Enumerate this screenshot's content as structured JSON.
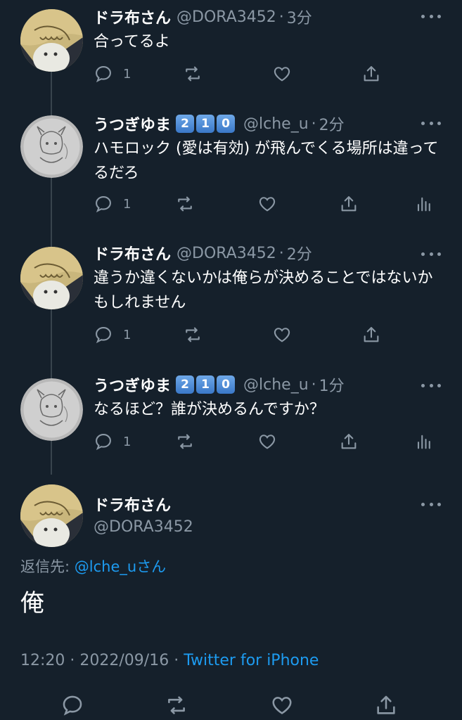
{
  "tweets": [
    {
      "name": "ドラ布さん",
      "handle": "@DORA3452",
      "dot": "·",
      "time": "3分",
      "text": "合ってるよ",
      "reply_count": "1",
      "verified_emoji": []
    },
    {
      "name": "うつぎゆま",
      "handle": "@lche_u",
      "dot": "·",
      "time": "2分",
      "text": "ハモロック (愛は有効) が飛んでくる場所は違ってるだろ",
      "reply_count": "1",
      "verified_emoji": [
        "2",
        "1",
        "0"
      ]
    },
    {
      "name": "ドラ布さん",
      "handle": "@DORA3452",
      "dot": "·",
      "time": "2分",
      "text": "違うか違くないかは俺らが決めることではないかもしれません",
      "reply_count": "1",
      "verified_emoji": []
    },
    {
      "name": "うつぎゆま",
      "handle": "@lche_u",
      "dot": "·",
      "time": "1分",
      "text": "なるほど？誰が決めるんですか？",
      "reply_count": "1",
      "verified_emoji": [
        "2",
        "1",
        "0"
      ]
    }
  ],
  "main_tweet": {
    "name": "ドラ布さん",
    "handle": "@DORA3452",
    "reply_prefix": "返信先:",
    "reply_mention": "@lche_u",
    "reply_suffix": "さん",
    "text": "俺",
    "time": "12:20",
    "separator": "·",
    "date": "2022/09/16",
    "source": "Twitter for iPhone"
  },
  "icons": {
    "reply": "reply-icon",
    "retweet": "retweet-icon",
    "like": "like-icon",
    "share": "share-icon",
    "analytics": "analytics-icon",
    "more": "more-icon"
  },
  "colors": {
    "background": "#15202b",
    "secondary_text": "#8b98a5",
    "link": "#1d9bf0",
    "thread_line": "#38444d"
  }
}
